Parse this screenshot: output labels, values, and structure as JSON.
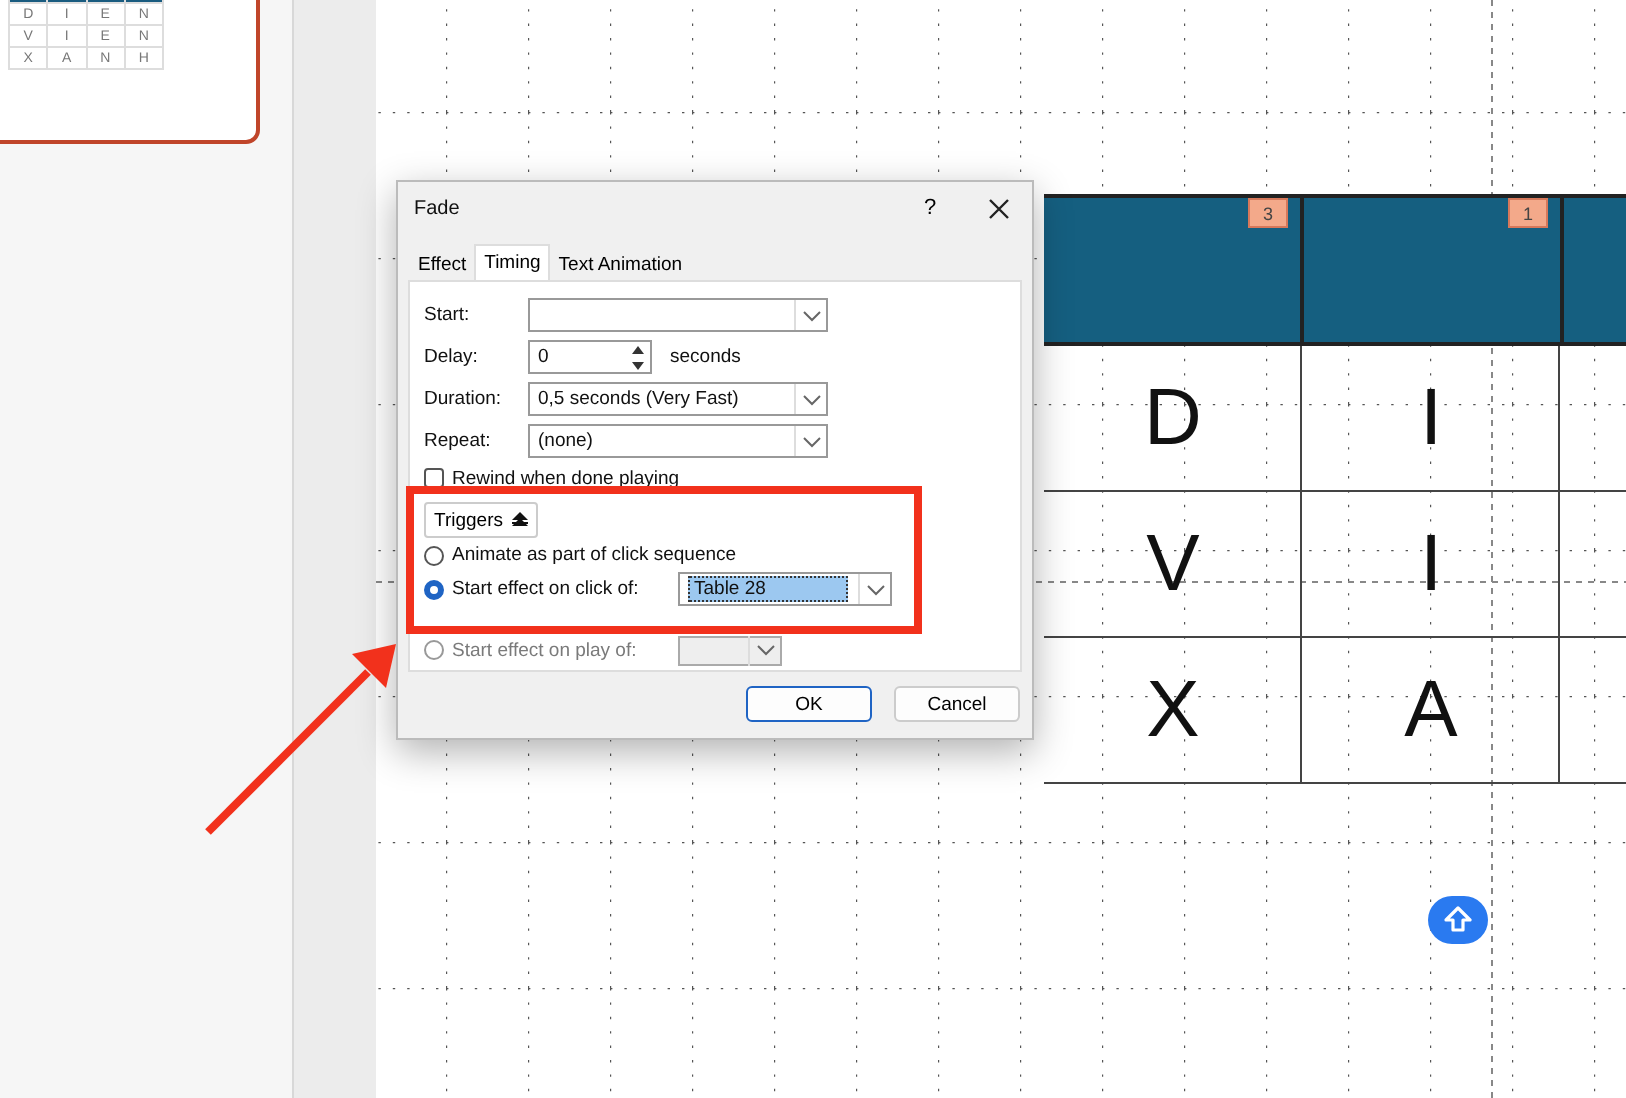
{
  "thumbnail": {
    "selected": true,
    "rows": [
      [
        "D",
        "I",
        "E",
        "N"
      ],
      [
        "V",
        "I",
        "E",
        "N"
      ],
      [
        "X",
        "A",
        "N",
        "H"
      ]
    ]
  },
  "slide_table": {
    "header_badges": [
      "3",
      "1"
    ],
    "rows": [
      [
        "D",
        "I"
      ],
      [
        "V",
        "I"
      ],
      [
        "X",
        "A"
      ]
    ]
  },
  "dialog": {
    "title": "Fade",
    "help": "?",
    "tabs": [
      {
        "label": "Effect",
        "selected": false
      },
      {
        "label": "Timing",
        "selected": true
      },
      {
        "label": "Text Animation",
        "selected": false
      }
    ],
    "fields": [
      {
        "kind": "dropdown",
        "label": "Start:"
      },
      {
        "kind": "spinner",
        "label": "Delay:",
        "value": "0",
        "unit": "seconds"
      },
      {
        "kind": "dropdown",
        "label": "Duration:",
        "value": "0,5 seconds (Very Fast)"
      },
      {
        "kind": "dropdown",
        "label": "Repeat:",
        "value": "(none)"
      }
    ],
    "rewind": {
      "label": "Rewind when done playing",
      "checked": false
    },
    "triggers_button": "Triggers",
    "trigger_options": [
      {
        "label": "Animate as part of click sequence",
        "selected": false,
        "disabled": false,
        "has_dropdown": false
      },
      {
        "label": "Start effect on click of:",
        "selected": true,
        "disabled": false,
        "has_dropdown": true,
        "value": "Table 28"
      },
      {
        "label": "Start effect on play of:",
        "selected": false,
        "disabled": true,
        "has_dropdown": true
      }
    ],
    "buttons": [
      {
        "label": "OK",
        "default": true
      },
      {
        "label": "Cancel",
        "default": false
      }
    ]
  }
}
